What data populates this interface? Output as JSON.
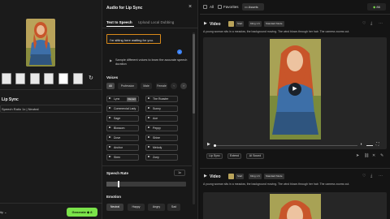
{
  "left": {
    "lip_sync_label": "Lip Sync",
    "speech_value": "Speech Ratio 1x | Neutral",
    "bottom_label": "ity",
    "generate_label": "Generate",
    "generate_cost": "8"
  },
  "middle": {
    "title": "Audio for Lip Sync",
    "tabs": [
      "Text to Speech",
      "Upload Local Dubbing"
    ],
    "text_value": "I'm sitting here waiting for you.",
    "sample_note": "Sample different voices to learn the accurate speech duration",
    "voices_label": "Voices",
    "filters": [
      "All",
      "Profession",
      "Male",
      "Female"
    ],
    "voices": [
      {
        "name": "Lynx",
        "badge": "Recent"
      },
      {
        "name": "The Roaster",
        "badge": ""
      },
      {
        "name": "Commercial Lady",
        "badge": ""
      },
      {
        "name": "Sunny",
        "badge": ""
      },
      {
        "name": "Sage",
        "badge": ""
      },
      {
        "name": "Ace",
        "badge": ""
      },
      {
        "name": "Blossom",
        "badge": ""
      },
      {
        "name": "Peppy",
        "badge": ""
      },
      {
        "name": "Dove",
        "badge": ""
      },
      {
        "name": "Shine",
        "badge": ""
      },
      {
        "name": "Anchor",
        "badge": ""
      },
      {
        "name": "Melody",
        "badge": ""
      },
      {
        "name": "Siren",
        "badge": ""
      },
      {
        "name": "Zoey",
        "badge": ""
      }
    ],
    "speech_rate_label": "Speech Rate",
    "speech_rate_value": "1x",
    "speech_rate_level": 0.15,
    "emotion_label": "Emotion",
    "emotions": [
      "Neutral",
      "Happy",
      "Angry",
      "Sad"
    ]
  },
  "topbar": {
    "all_label": "All",
    "favorites_label": "Favorites",
    "assets_label": "Assets",
    "credits": "86"
  },
  "cards": [
    {
      "type_label": "Video",
      "chips": [
        "Start",
        "Kling 1.6",
        "Standard Mode"
      ],
      "prompt": "A young woman sits in a meadow, the background moving. The wind blows through her hair. The camera zooms out.",
      "actions": [
        "Lip Sync",
        "Extend",
        "AI Sound"
      ]
    },
    {
      "type_label": "Video",
      "chips": [
        "Start",
        "Kling 1.6",
        "Standard Mode"
      ],
      "prompt": "A young woman sits in a meadow, the background moving. The wind blows through her hair. The camera zooms out."
    }
  ],
  "colors": {
    "accent_green": "#7be34a",
    "focus_orange": "#d98a1a",
    "hair": "#c8552a",
    "denim": "#3d6fa8",
    "meadow": "#7a8a3c"
  }
}
